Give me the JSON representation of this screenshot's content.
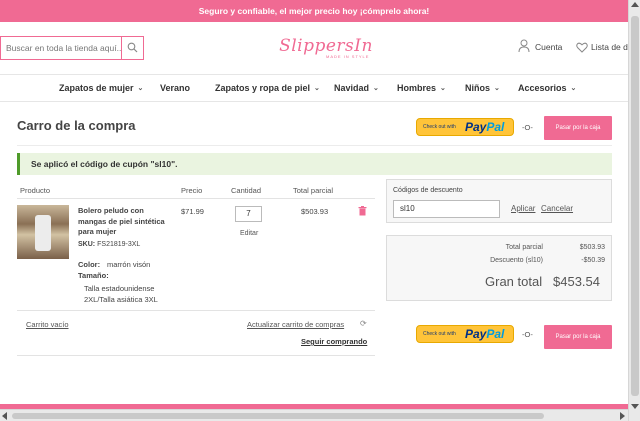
{
  "promo_bar": {
    "text": "Seguro y confiable, el mejor precio hoy ¡cómprelo ahora!"
  },
  "header": {
    "search_placeholder": "Buscar en toda la tienda aquí...",
    "logo_text": "SlippersIn",
    "logo_tagline": "MADE IN STYLE",
    "account_label": "Cuenta",
    "wishlist_label": "Lista de d"
  },
  "nav": {
    "items": [
      {
        "label": "Zapatos de mujer",
        "has_dropdown": true
      },
      {
        "label": "Verano",
        "has_dropdown": false
      },
      {
        "label": "Zapatos y ropa de piel",
        "has_dropdown": true
      },
      {
        "label": "Navidad",
        "has_dropdown": true
      },
      {
        "label": "Hombres",
        "has_dropdown": true
      },
      {
        "label": "Niños",
        "has_dropdown": true
      },
      {
        "label": "Accesorios",
        "has_dropdown": true
      }
    ]
  },
  "cart": {
    "title": "Carro de la compra",
    "paypal_prefix": "Check out with",
    "paypal_brand_a": "Pay",
    "paypal_brand_b": "Pal",
    "or_separator": "-O-",
    "checkout_label": "Pasar por la caja",
    "coupon_message": "Se aplicó el código de cupón \"sl10\".",
    "columns": {
      "product": "Producto",
      "price": "Precio",
      "qty": "Cantidad",
      "subtotal": "Total parcial"
    },
    "item": {
      "name": "Bolero peludo con mangas de piel sintética para mujer",
      "sku_label": "SKU:",
      "sku": "FS21819-3XL",
      "color_label": "Color:",
      "color_value": "marrón visón",
      "size_label": "Tamaño:",
      "size_value_1": "Talla estadounidense",
      "size_value_2": "2XL/Talla asiática 3XL",
      "price": "$71.99",
      "qty": "7",
      "edit_label": "Editar",
      "subtotal": "$503.93"
    },
    "links": {
      "empty_cart": "Carrito vacío",
      "update_cart": "Actualizar carrito de compras",
      "continue_shopping": "Seguir comprando"
    }
  },
  "discount": {
    "label": "Códigos de descuento",
    "code": "sl10",
    "apply_label": "Aplicar",
    "cancel_label": "Cancelar"
  },
  "totals": {
    "subtotal_label": "Total parcial",
    "subtotal_value": "$503.93",
    "discount_label": "Descuento (sl10)",
    "discount_value": "-$50.39",
    "grand_label": "Gran total",
    "grand_value": "$453.54"
  },
  "colors": {
    "brand": "#f06a93",
    "paypal": "#ffc439",
    "success": "#eaf4e0"
  },
  "icons": [
    "search-icon",
    "user-icon",
    "heart-icon",
    "chevron-down-icon",
    "trash-icon",
    "refresh-icon"
  ]
}
